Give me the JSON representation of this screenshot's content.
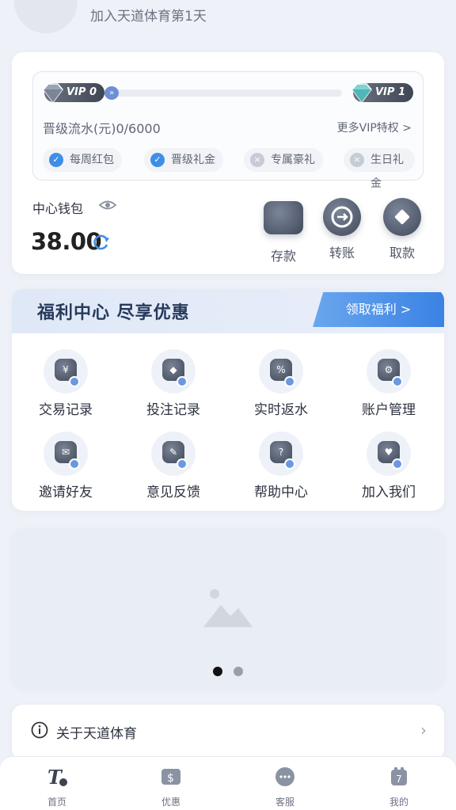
{
  "profile": {
    "join_text": "加入天道体育第1天"
  },
  "vip": {
    "current_level": "VIP 0",
    "next_level": "VIP 1",
    "progress_fraction": 0.0,
    "flow_text": "晋级流水(元)0/6000",
    "more_link": "更多VIP特权 >",
    "perks": [
      {
        "label": "每周红包",
        "enabled": true
      },
      {
        "label": "晋级礼金",
        "enabled": true
      },
      {
        "label": "专属豪礼",
        "enabled": false
      },
      {
        "label": "生日礼金",
        "enabled": false
      }
    ]
  },
  "wallet": {
    "label": "中心钱包",
    "balance": "38.00",
    "actions": [
      {
        "label": "存款",
        "icon": "wallet-icon"
      },
      {
        "label": "转账",
        "icon": "transfer-icon"
      },
      {
        "label": "取款",
        "icon": "withdraw-icon"
      }
    ]
  },
  "welfare": {
    "title": "福利中心 尽享优惠",
    "claim_label": "领取福利 >",
    "items": [
      {
        "label": "交易记录",
        "icon": "transaction-record-icon",
        "glyph": "¥"
      },
      {
        "label": "投注记录",
        "icon": "bet-record-icon",
        "glyph": "◆"
      },
      {
        "label": "实时返水",
        "icon": "rebate-icon",
        "glyph": "%"
      },
      {
        "label": "账户管理",
        "icon": "account-settings-icon",
        "glyph": "⚙"
      },
      {
        "label": "邀请好友",
        "icon": "invite-friend-icon",
        "glyph": "✉"
      },
      {
        "label": "意见反馈",
        "icon": "feedback-icon",
        "glyph": "✎"
      },
      {
        "label": "帮助中心",
        "icon": "help-icon",
        "glyph": "?"
      },
      {
        "label": "加入我们",
        "icon": "join-us-icon",
        "glyph": "♥"
      }
    ]
  },
  "banner": {
    "slides": 2,
    "active_slide": 1
  },
  "about": {
    "label": "关于天道体育"
  },
  "tabbar": {
    "tabs": [
      {
        "label": "首页",
        "icon": "home-logo-icon"
      },
      {
        "label": "优惠",
        "icon": "promo-icon"
      },
      {
        "label": "客服",
        "icon": "support-chat-icon"
      },
      {
        "label": "我的",
        "icon": "profile-icon"
      }
    ]
  },
  "colors": {
    "accent": "#3a82e4",
    "dark_icon": "#40495a",
    "background": "#eef1f7"
  }
}
